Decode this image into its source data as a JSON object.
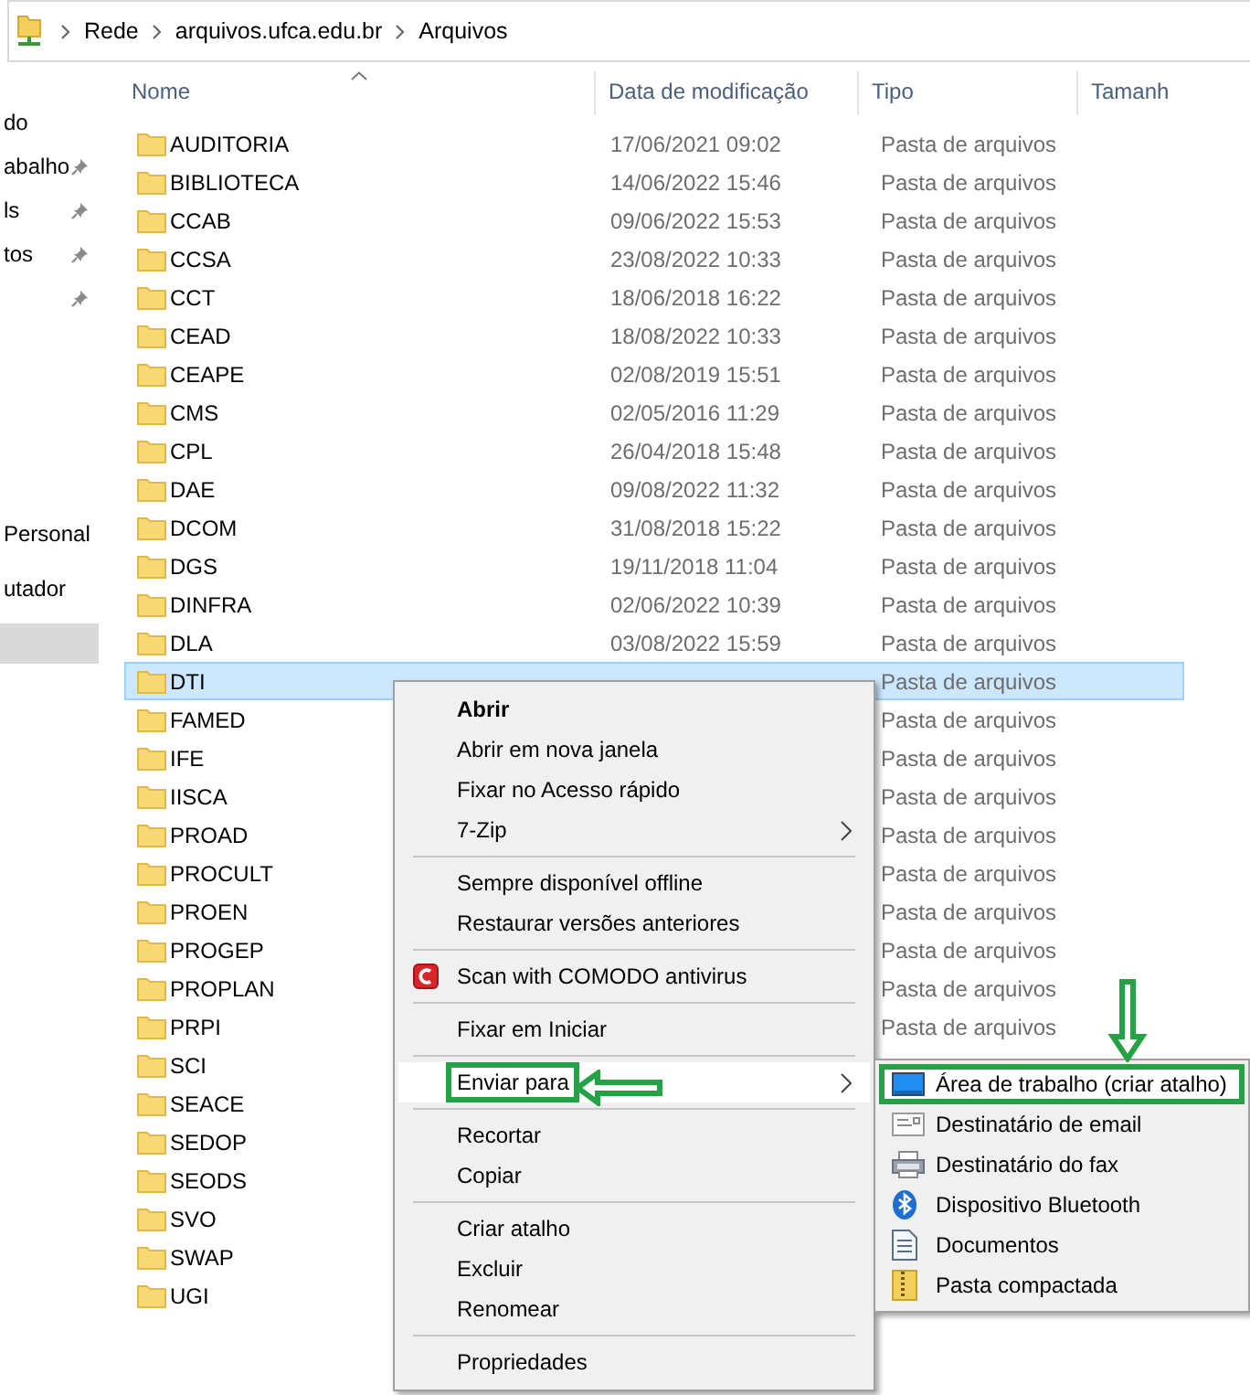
{
  "address": {
    "crumbs": [
      "Rede",
      "arquivos.ufca.edu.br",
      "Arquivos"
    ]
  },
  "nav": {
    "sections": [
      {
        "items": [
          {
            "label": "do",
            "pinned": false,
            "selected": false
          },
          {
            "label": "abalho",
            "pinned": true,
            "selected": false
          },
          {
            "label": "ls",
            "pinned": true,
            "selected": false
          },
          {
            "label": "tos",
            "pinned": true,
            "selected": false
          },
          {
            "pinned": true,
            "selected": false
          }
        ]
      },
      {
        "items": [
          {
            "label": "Personal",
            "pinned": false,
            "selected": false
          },
          {
            "label": "utador",
            "pinned": false,
            "selected": false
          },
          {
            "pinned": false,
            "selected": true
          }
        ]
      }
    ]
  },
  "files": {
    "columns": [
      {
        "label": "Nome",
        "sorted": true
      },
      {
        "label": "Data de modificação",
        "sorted": false
      },
      {
        "label": "Tipo",
        "sorted": false
      },
      {
        "label": "Tamanh",
        "sorted": false
      }
    ],
    "rows": [
      {
        "name": "AUDITORIA",
        "date": "17/06/2021 09:02",
        "type": "Pasta de arquivos",
        "selected": false
      },
      {
        "name": "BIBLIOTECA",
        "date": "14/06/2022 15:46",
        "type": "Pasta de arquivos",
        "selected": false
      },
      {
        "name": "CCAB",
        "date": "09/06/2022 15:53",
        "type": "Pasta de arquivos",
        "selected": false
      },
      {
        "name": "CCSA",
        "date": "23/08/2022 10:33",
        "type": "Pasta de arquivos",
        "selected": false
      },
      {
        "name": "CCT",
        "date": "18/06/2018 16:22",
        "type": "Pasta de arquivos",
        "selected": false
      },
      {
        "name": "CEAD",
        "date": "18/08/2022 10:33",
        "type": "Pasta de arquivos",
        "selected": false
      },
      {
        "name": "CEAPE",
        "date": "02/08/2019 15:51",
        "type": "Pasta de arquivos",
        "selected": false
      },
      {
        "name": "CMS",
        "date": "02/05/2016 11:29",
        "type": "Pasta de arquivos",
        "selected": false
      },
      {
        "name": "CPL",
        "date": "26/04/2018 15:48",
        "type": "Pasta de arquivos",
        "selected": false
      },
      {
        "name": "DAE",
        "date": "09/08/2022 11:32",
        "type": "Pasta de arquivos",
        "selected": false
      },
      {
        "name": "DCOM",
        "date": "31/08/2018 15:22",
        "type": "Pasta de arquivos",
        "selected": false
      },
      {
        "name": "DGS",
        "date": "19/11/2018 11:04",
        "type": "Pasta de arquivos",
        "selected": false
      },
      {
        "name": "DINFRA",
        "date": "02/06/2022 10:39",
        "type": "Pasta de arquivos",
        "selected": false
      },
      {
        "name": "DLA",
        "date": "03/08/2022 15:59",
        "type": "Pasta de arquivos",
        "selected": false
      },
      {
        "name": "DTI",
        "type": "Pasta de arquivos",
        "selected": true
      },
      {
        "name": "FAMED",
        "type": "Pasta de arquivos",
        "selected": false
      },
      {
        "name": "IFE",
        "type": "Pasta de arquivos",
        "selected": false
      },
      {
        "name": "IISCA",
        "type": "Pasta de arquivos",
        "selected": false
      },
      {
        "name": "PROAD",
        "type": "Pasta de arquivos",
        "selected": false
      },
      {
        "name": "PROCULT",
        "type": "Pasta de arquivos",
        "selected": false
      },
      {
        "name": "PROEN",
        "type": "Pasta de arquivos",
        "selected": false
      },
      {
        "name": "PROGEP",
        "type": "Pasta de arquivos",
        "selected": false
      },
      {
        "name": "PROPLAN",
        "type": "Pasta de arquivos",
        "selected": false
      },
      {
        "name": "PRPI",
        "type": "Pasta de arquivos",
        "selected": false
      },
      {
        "name": "SCI",
        "selected": false
      },
      {
        "name": "SEACE",
        "selected": false
      },
      {
        "name": "SEDOP",
        "selected": false
      },
      {
        "name": "SEODS",
        "selected": false
      },
      {
        "name": "SVO",
        "selected": false
      },
      {
        "name": "SWAP",
        "selected": false
      },
      {
        "name": "UGI",
        "selected": false
      }
    ]
  },
  "context_menu": {
    "items": [
      {
        "kind": "item",
        "label": "Abrir",
        "bold": true,
        "has_submenu": false,
        "highlighted": false,
        "annotated": false
      },
      {
        "kind": "item",
        "label": "Abrir em nova janela",
        "bold": false,
        "has_submenu": false,
        "highlighted": false,
        "annotated": false
      },
      {
        "kind": "item",
        "label": "Fixar no Acesso rápido",
        "bold": false,
        "has_submenu": false,
        "highlighted": false,
        "annotated": false
      },
      {
        "kind": "item",
        "label": "7-Zip",
        "bold": false,
        "has_submenu": true,
        "highlighted": false,
        "annotated": false
      },
      {
        "kind": "separator"
      },
      {
        "kind": "item",
        "label": "Sempre disponível offline",
        "bold": false,
        "has_submenu": false,
        "highlighted": false,
        "annotated": false
      },
      {
        "kind": "item",
        "label": "Restaurar versões anteriores",
        "bold": false,
        "has_submenu": false,
        "highlighted": false,
        "annotated": false
      },
      {
        "kind": "separator"
      },
      {
        "kind": "icon_item",
        "label": "Scan with COMODO antivirus",
        "bold": false,
        "has_submenu": false,
        "highlighted": false,
        "annotated": false
      },
      {
        "kind": "separator"
      },
      {
        "kind": "item",
        "label": "Fixar em Iniciar",
        "bold": false,
        "has_submenu": false,
        "highlighted": false,
        "annotated": false
      },
      {
        "kind": "separator"
      },
      {
        "kind": "item",
        "label": "Enviar para",
        "bold": false,
        "has_submenu": true,
        "highlighted": true,
        "annotated": true
      },
      {
        "kind": "separator"
      },
      {
        "kind": "item",
        "label": "Recortar",
        "bold": false,
        "has_submenu": false,
        "highlighted": false,
        "annotated": false
      },
      {
        "kind": "item",
        "label": "Copiar",
        "bold": false,
        "has_submenu": false,
        "highlighted": false,
        "annotated": false
      },
      {
        "kind": "separator"
      },
      {
        "kind": "item",
        "label": "Criar atalho",
        "bold": false,
        "has_submenu": false,
        "highlighted": false,
        "annotated": false
      },
      {
        "kind": "item",
        "label": "Excluir",
        "bold": false,
        "has_submenu": false,
        "highlighted": false,
        "annotated": false
      },
      {
        "kind": "item",
        "label": "Renomear",
        "bold": false,
        "has_submenu": false,
        "highlighted": false,
        "annotated": false
      },
      {
        "kind": "separator"
      },
      {
        "kind": "item",
        "label": "Propriedades",
        "bold": false,
        "has_submenu": false,
        "highlighted": false,
        "annotated": false
      }
    ]
  },
  "send_to_menu": {
    "items": [
      {
        "label": "Área de trabalho (criar atalho)",
        "kind": "desktop",
        "highlighted": true,
        "annotated": true
      },
      {
        "label": "Destinatário de email",
        "kind": "mail",
        "highlighted": false,
        "annotated": false
      },
      {
        "label": "Destinatário do fax",
        "kind": "fax",
        "highlighted": false,
        "annotated": false
      },
      {
        "label": "Dispositivo Bluetooth",
        "kind": "bluetooth",
        "highlighted": false,
        "annotated": false
      },
      {
        "label": "Documentos",
        "kind": "document",
        "highlighted": false,
        "annotated": false
      },
      {
        "label": "Pasta compactada",
        "kind": "zip",
        "highlighted": false,
        "annotated": false
      }
    ]
  }
}
